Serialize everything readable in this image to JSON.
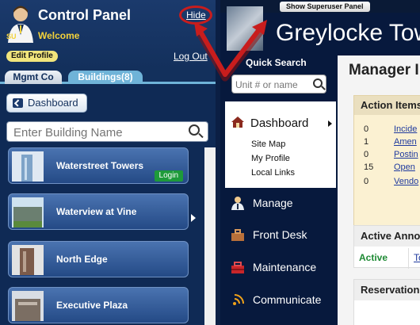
{
  "control_panel": {
    "title": "Control Panel",
    "welcome": "Welcome",
    "avatar_initials": "SU",
    "hide_label": "Hide",
    "edit_profile_label": "Edit Profile",
    "logout_label": "Log Out",
    "tabs": [
      {
        "label": "Mgmt Co",
        "active": false
      },
      {
        "label": "Buildings(8)",
        "active": true
      }
    ],
    "dashboard_button": "Dashboard",
    "building_search": {
      "placeholder": "Enter Building Name"
    },
    "buildings": [
      {
        "name": "Waterstreet Towers",
        "login_label": "Login",
        "icon": "tower-thumbnail"
      },
      {
        "name": "Waterview at Vine",
        "icon": "building-thumbnail"
      },
      {
        "name": "North Edge",
        "icon": "building-thumbnail"
      },
      {
        "name": "Executive Plaza",
        "icon": "building-thumbnail"
      }
    ]
  },
  "site": {
    "superuser_button": "Show Superuser Panel",
    "brand": "Greylocke Towe",
    "quick_search": {
      "label": "Quick Search",
      "placeholder": "Unit # or name"
    },
    "nav": {
      "dashboard": "Dashboard",
      "sub_links": [
        "Site Map",
        "My Profile",
        "Local Links"
      ],
      "items": [
        {
          "label": "Manage",
          "icon": "manage-icon"
        },
        {
          "label": "Front Desk",
          "icon": "front-desk-icon"
        },
        {
          "label": "Maintenance",
          "icon": "maintenance-icon"
        },
        {
          "label": "Communicate",
          "icon": "communicate-icon"
        }
      ]
    },
    "main": {
      "title": "Manager I",
      "action_items": {
        "heading": "Action Items",
        "rows": [
          {
            "count": "0",
            "label": "Incide"
          },
          {
            "count": "1",
            "label": "Amen"
          },
          {
            "count": "0",
            "label": "Postin"
          },
          {
            "count": "15",
            "label": "Open"
          },
          {
            "count": "0",
            "label": "Vendo"
          }
        ]
      },
      "announcements": {
        "heading": "Active Anno",
        "status": "Active",
        "link": "To"
      },
      "reservations": {
        "heading": "Reservation"
      }
    }
  },
  "colors": {
    "hide_ring": "#c81d1d",
    "annotation_arrow": "#c81d1d",
    "login_badge": "#1e9a3a",
    "welcome": "#f3d23a"
  }
}
